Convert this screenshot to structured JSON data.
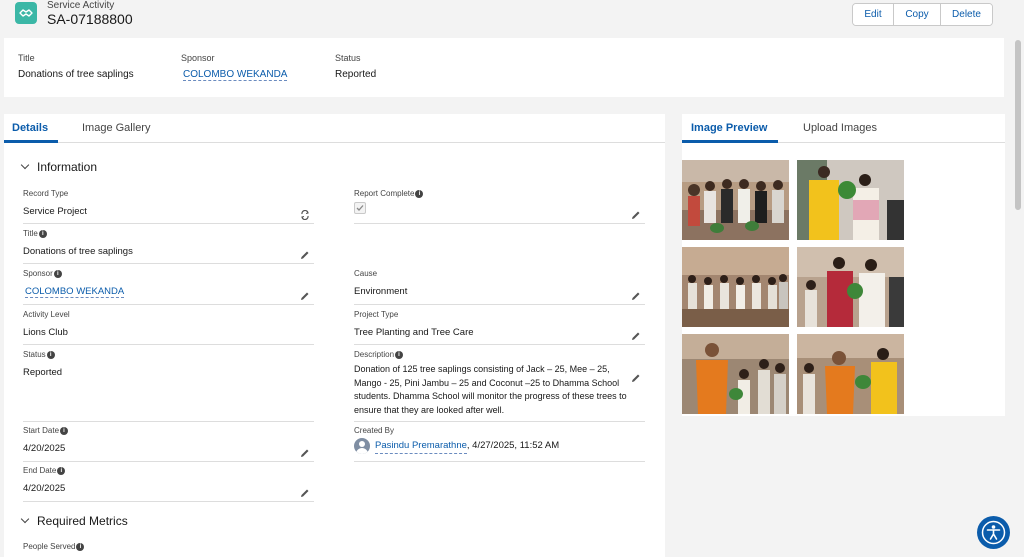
{
  "header": {
    "object_label": "Service Activity",
    "record_name": "SA-07188800",
    "actions": [
      "Edit",
      "Copy",
      "Delete"
    ]
  },
  "highlights": {
    "title_label": "Title",
    "title_value": "Donations of tree saplings",
    "sponsor_label": "Sponsor",
    "sponsor_value": "COLOMBO WEKANDA",
    "status_label": "Status",
    "status_value": "Reported"
  },
  "left_tabs": [
    "Details",
    "Image Gallery"
  ],
  "right_tabs": [
    "Image Preview",
    "Upload Images"
  ],
  "sections": {
    "information": "Information",
    "required_metrics": "Required Metrics"
  },
  "fields": {
    "record_type": {
      "label": "Record Type",
      "value": "Service Project"
    },
    "report_complete": {
      "label": "Report Complete",
      "checked": true
    },
    "title": {
      "label": "Title",
      "value": "Donations of tree saplings"
    },
    "sponsor": {
      "label": "Sponsor",
      "value": "COLOMBO WEKANDA"
    },
    "cause": {
      "label": "Cause",
      "value": "Environment"
    },
    "activity_level": {
      "label": "Activity Level",
      "value": "Lions Club"
    },
    "project_type": {
      "label": "Project Type",
      "value": "Tree Planting and Tree Care"
    },
    "status": {
      "label": "Status",
      "value": "Reported"
    },
    "description": {
      "label": "Description",
      "value": "Donation of 125 tree saplings consisting of Jack – 25, Mee – 25, Mango - 25, Pini Jambu – 25 and Coconut –25 to Dhamma School students. Dhamma School will monitor the progress of these trees to ensure that they are looked after well."
    },
    "start_date": {
      "label": "Start Date",
      "value": "4/20/2025"
    },
    "created_by": {
      "label": "Created By",
      "user": "Pasindu Premarathne",
      "timestamp": ", 4/27/2025, 11:52 AM"
    },
    "end_date": {
      "label": "End Date",
      "value": "4/20/2025"
    },
    "people_served": {
      "label": "People Served"
    }
  },
  "colors": {
    "brand_blue": "#0b5cab",
    "icon_teal": "#3bb7a6"
  }
}
